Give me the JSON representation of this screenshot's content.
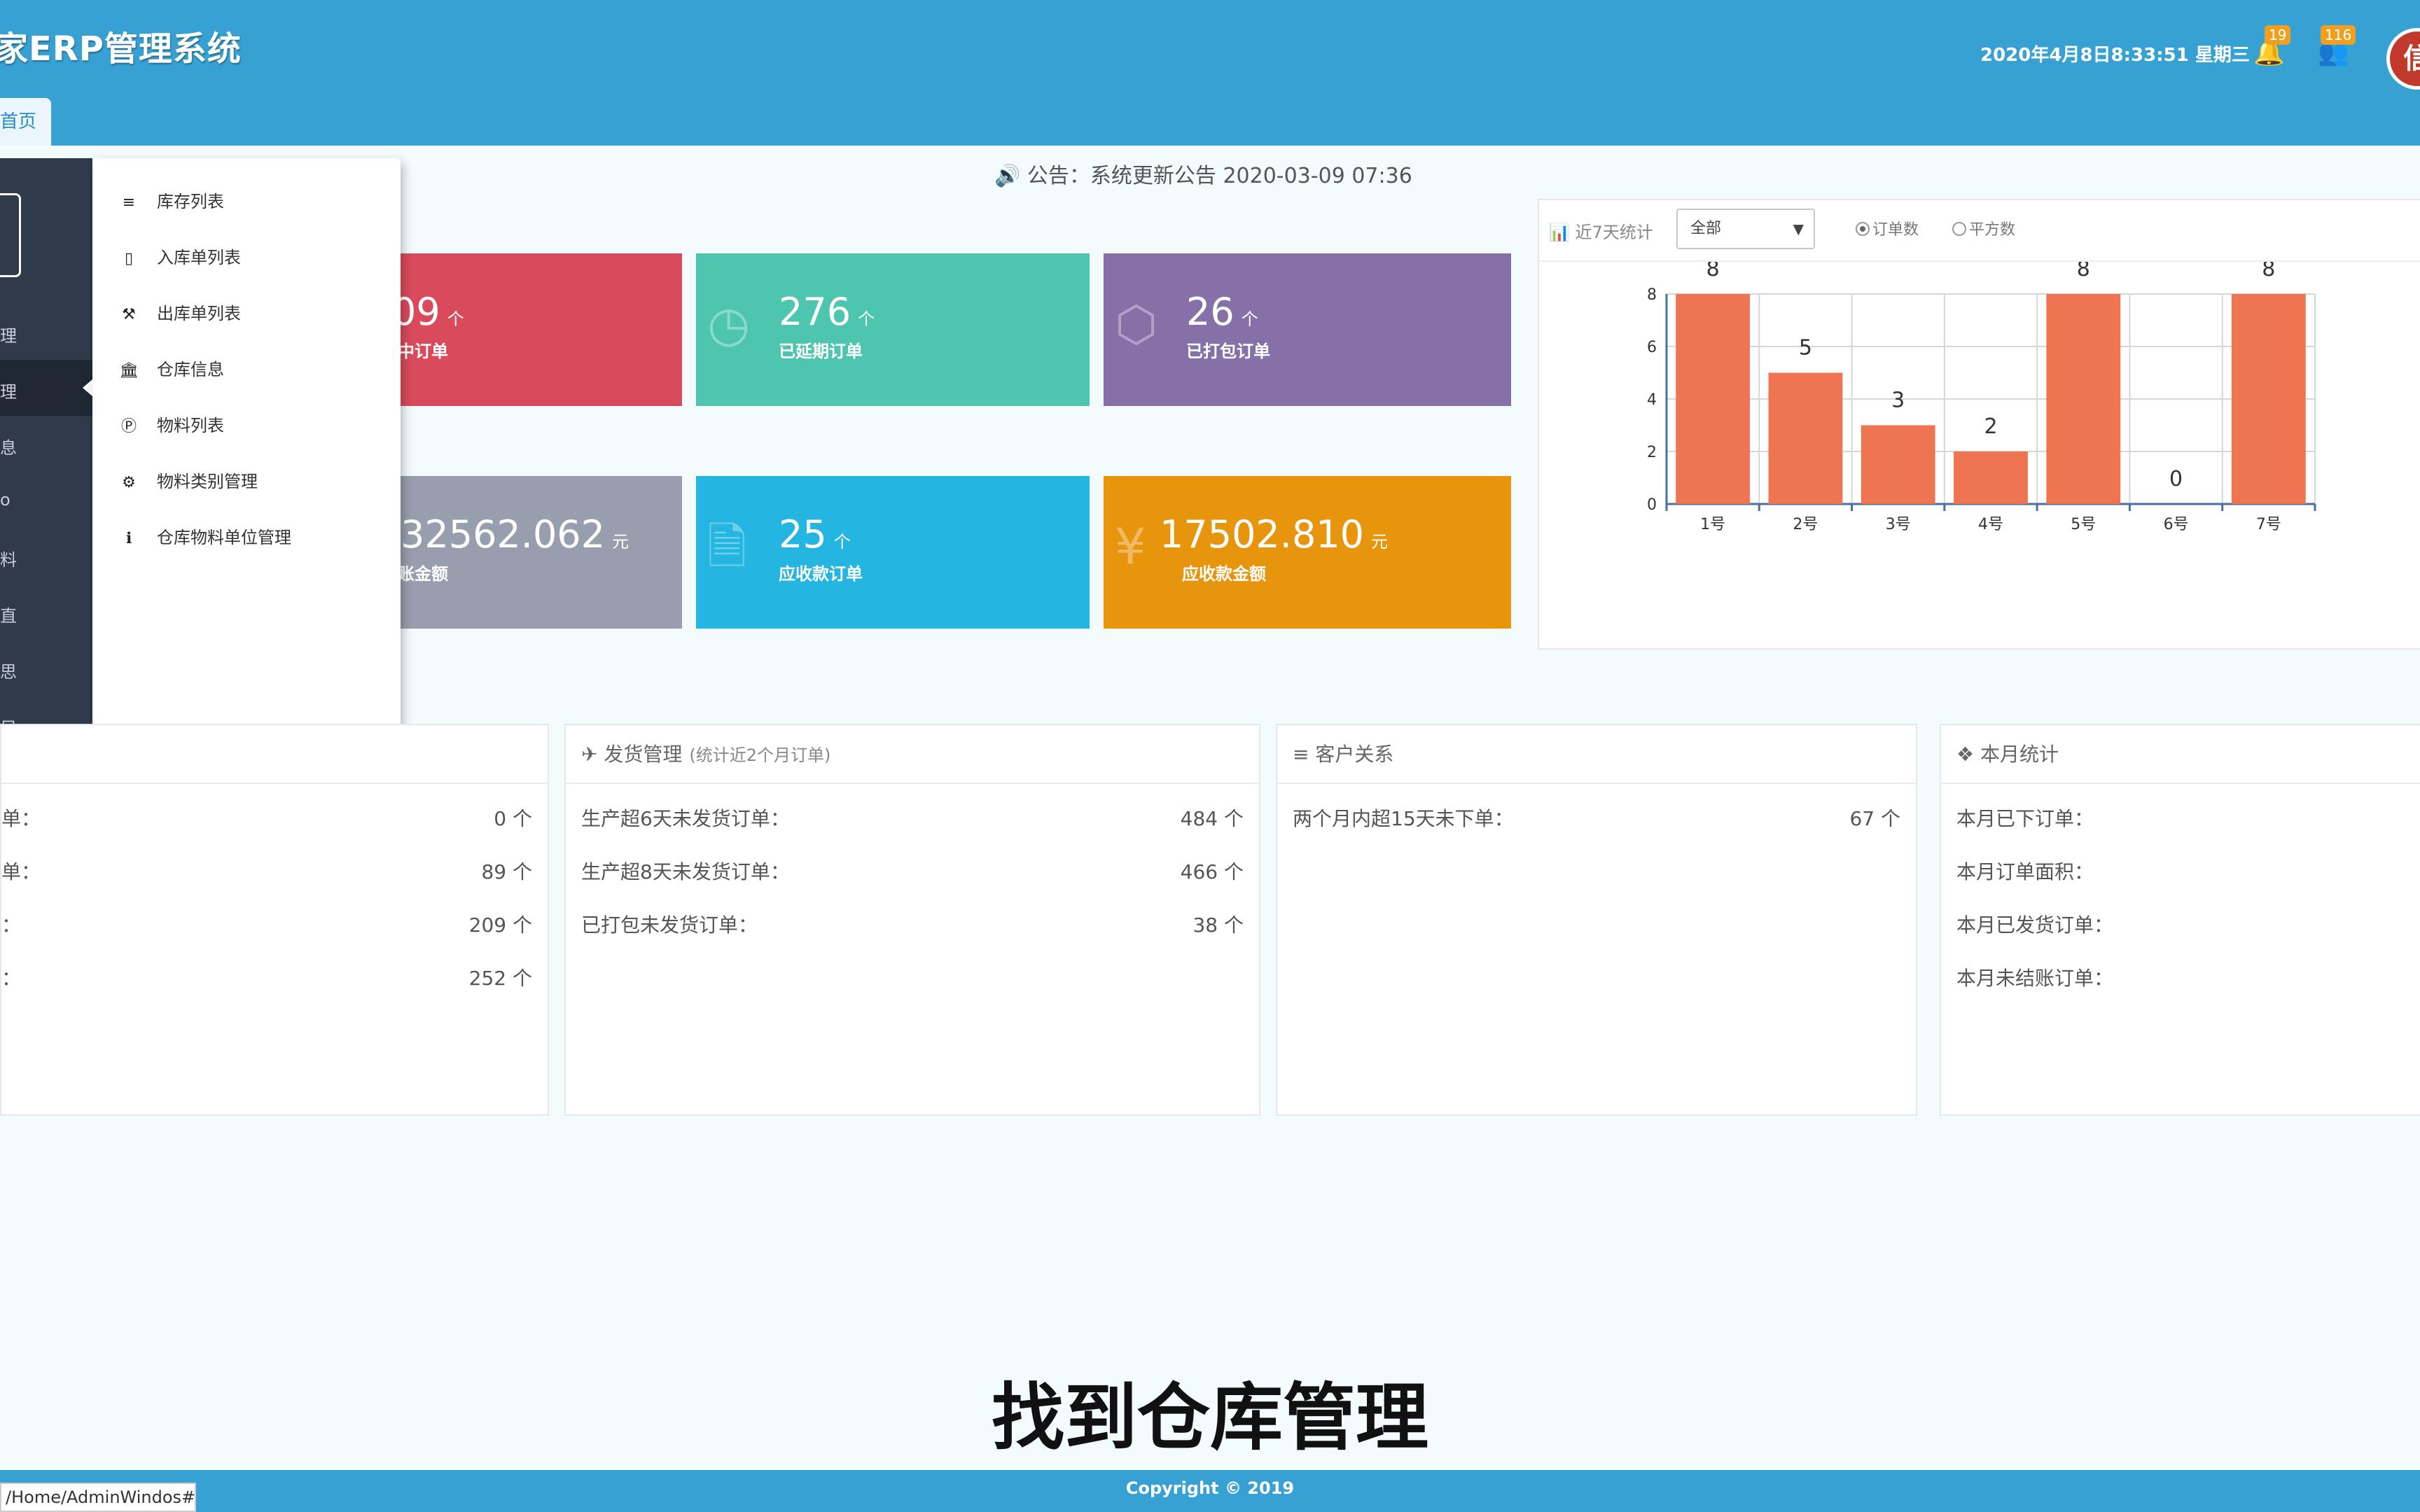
{
  "header": {
    "logo_text": "家ERP管理系统",
    "datetime": "2020年4月8日8:33:51 星期三",
    "notification_count": "19",
    "user_count": "116",
    "avatar_text": "信"
  },
  "tabs": {
    "home": "首页"
  },
  "notice": {
    "icon": "speaker-icon",
    "text": "公告：系统更新公告 2020-03-09 07:36"
  },
  "tiles": [
    {
      "number": "09",
      "unit": "个",
      "label": "中订单",
      "color": "#d94b5c",
      "icon": "none"
    },
    {
      "number": "276",
      "unit": "个",
      "label": "已延期订单",
      "color": "#4ec5ae",
      "icon": "clock-icon"
    },
    {
      "number": "26",
      "unit": "个",
      "label": "已打包订单",
      "color": "#8570a8",
      "icon": "package-icon"
    },
    {
      "number": "32562.062",
      "unit": "元",
      "label": "账金额",
      "color": "#979fae",
      "icon": "none"
    },
    {
      "number": "25",
      "unit": "个",
      "label": "应收款订单",
      "color": "#24b6e0",
      "icon": "document-icon"
    },
    {
      "number": "17502.810",
      "unit": "元",
      "label": "应收款金额",
      "color": "#e8950e",
      "icon": "yen-icon"
    }
  ],
  "chart_panel": {
    "title": "近7天统计",
    "select_value": "全部",
    "radio_orders": "订单数",
    "radio_area": "平方数"
  },
  "chart_data": {
    "type": "bar",
    "categories": [
      "1号",
      "2号",
      "3号",
      "4号",
      "5号",
      "6号",
      "7号"
    ],
    "values": [
      8,
      5,
      3,
      2,
      8,
      0,
      8
    ],
    "yticks": [
      0,
      2,
      4,
      6,
      8
    ],
    "ylim": [
      0,
      8
    ],
    "bar_color": "#ef7452",
    "grid": true
  },
  "panels": [
    {
      "title": "",
      "rows": [
        {
          "label": "单：",
          "value": "0 个"
        },
        {
          "label": "单：",
          "value": "89 个"
        },
        {
          "label": "：",
          "value": "209 个"
        },
        {
          "label": "：",
          "value": "252 个"
        }
      ]
    },
    {
      "title": "发货管理",
      "subtitle": "(统计近2个月订单)",
      "rows": [
        {
          "label": "生产超6天未发货订单：",
          "value": "484 个"
        },
        {
          "label": "生产超8天未发货订单：",
          "value": "466 个"
        },
        {
          "label": "已打包未发货订单：",
          "value": "38 个"
        }
      ]
    },
    {
      "title": "客户关系",
      "rows": [
        {
          "label": "两个月内超15天未下单：",
          "value": "67 个"
        }
      ]
    },
    {
      "title": "本月统计",
      "rows": [
        {
          "label": "本月已下订单：",
          "value": ""
        },
        {
          "label": "本月订单面积：",
          "value": ""
        },
        {
          "label": "本月已发货订单：",
          "value": ""
        },
        {
          "label": "本月未结账订单：",
          "value": ""
        }
      ]
    }
  ],
  "sidebar_fragments": [
    "理",
    "理",
    "息",
    "o",
    "料",
    "直",
    "思",
    "只"
  ],
  "dropdown_menu": [
    {
      "label": "库存列表",
      "icon": "list-icon"
    },
    {
      "label": "入库单列表",
      "icon": "receipt-icon"
    },
    {
      "label": "出库单列表",
      "icon": "gavel-icon"
    },
    {
      "label": "仓库信息",
      "icon": "bank-icon"
    },
    {
      "label": "物料列表",
      "icon": "circle-p-icon"
    },
    {
      "label": "物料类别管理",
      "icon": "gear-icon"
    },
    {
      "label": "仓库物料单位管理",
      "icon": "info-icon"
    }
  ],
  "caption": "找到仓库管理",
  "footer": {
    "copyright": "Copyright © 2019"
  },
  "statusbar": {
    "url": "/Home/AdminWindos#"
  }
}
